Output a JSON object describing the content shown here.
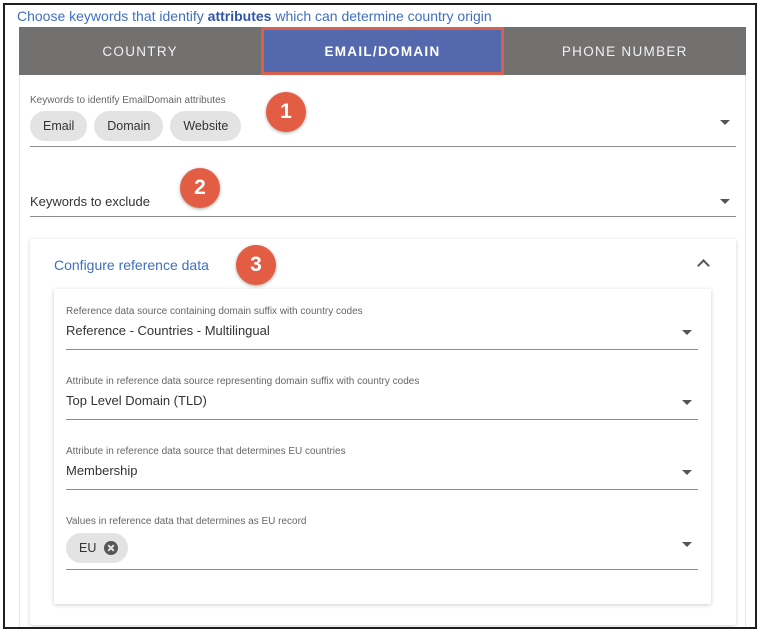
{
  "header": {
    "prefix": "Choose keywords that identify ",
    "emphasis": "attributes",
    "suffix": " which can determine country origin"
  },
  "tabs": [
    {
      "label": "COUNTRY",
      "active": false
    },
    {
      "label": "EMAIL/DOMAIN",
      "active": true
    },
    {
      "label": "PHONE NUMBER",
      "active": false
    }
  ],
  "keywords_field": {
    "label": "Keywords to identify EmailDomain attributes",
    "chips": [
      "Email",
      "Domain",
      "Website"
    ]
  },
  "exclude_field": {
    "label": "Keywords to exclude"
  },
  "reference": {
    "title": "Configure reference data",
    "fields": [
      {
        "label": "Reference data source containing domain suffix with country codes",
        "value": "Reference - Countries - Multilingual"
      },
      {
        "label": "Attribute in reference data source representing domain suffix with country codes",
        "value": "Top Level Domain (TLD)"
      },
      {
        "label": "Attribute in reference data source that determines EU countries",
        "value": "Membership"
      },
      {
        "label": "Values in reference data that determines as EU record",
        "chips": [
          "EU"
        ]
      }
    ]
  },
  "badges": [
    "1",
    "2",
    "3"
  ],
  "colors": {
    "accent": "#3f6fbf",
    "tab_bar": "#737070",
    "tab_active": "#5468ad",
    "highlight": "#d9614c",
    "badge": "#e35c44"
  }
}
